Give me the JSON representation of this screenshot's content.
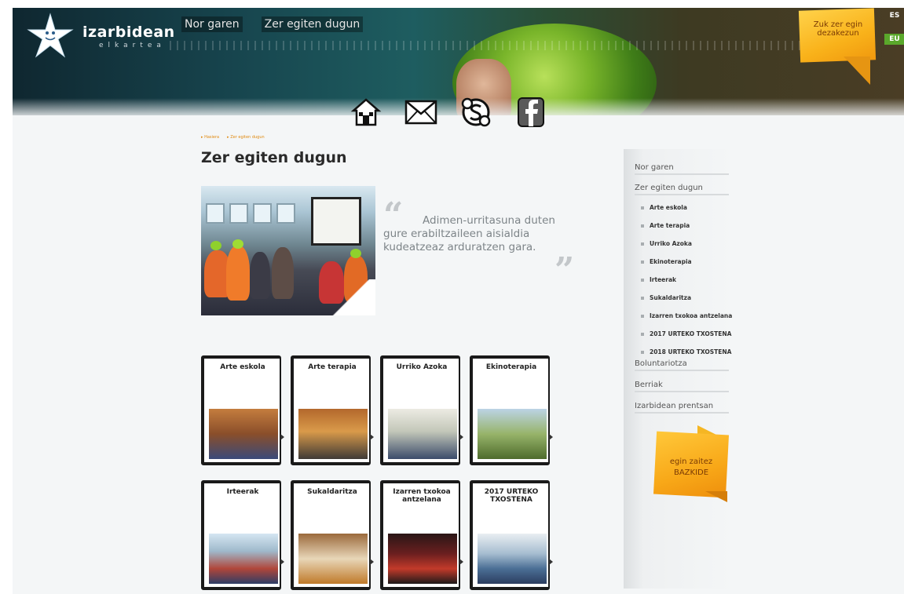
{
  "brand": {
    "name": "izarbidean",
    "tagline": "elkartea"
  },
  "top_nav": [
    "Nor garen",
    "Zer egiten dugun"
  ],
  "cta_top": "Zuk zer egin dezakezun",
  "languages": {
    "es": "ES",
    "eu": "EU"
  },
  "social_icons": [
    "home-icon",
    "mail-icon",
    "skype-icon",
    "facebook-icon"
  ],
  "breadcrumb": [
    "Hasiera",
    "Zer egiten dugun"
  ],
  "page_title": {
    "first": "Z",
    "rest": "er egiten dugun"
  },
  "quote": "Adimen-urritasuna duten gure erabiltzaileen aisialdia kudeatzeaz arduratzen gara.",
  "cards": [
    "Arte eskola",
    "Arte terapia",
    "Urriko Azoka",
    "Ekinoterapia",
    "Irteerak",
    "Sukaldaritza",
    "Izarren txokoa antzelana",
    "2017 URTEKO TXOSTENA"
  ],
  "sidebar": {
    "items_top": [
      "Nor garen",
      "Zer egiten dugun"
    ],
    "subitems": [
      "Arte eskola",
      "Arte terapia",
      "Urriko Azoka",
      "Ekinoterapia",
      "Irteerak",
      "Sukaldaritza",
      "Izarren txokoa antzelana",
      "2017 URTEKO TXOSTENA",
      "2018 URTEKO TXOSTENA"
    ],
    "items_bottom": [
      "Boluntariotza",
      "Berriak",
      "Izarbidean prentsan"
    ]
  },
  "cta_side": "egin zaitez BAZKIDE",
  "colors": {
    "accent": "#f9b21a",
    "eu_flag": "#5aa82b",
    "breadcrumb": "#e08a10"
  }
}
